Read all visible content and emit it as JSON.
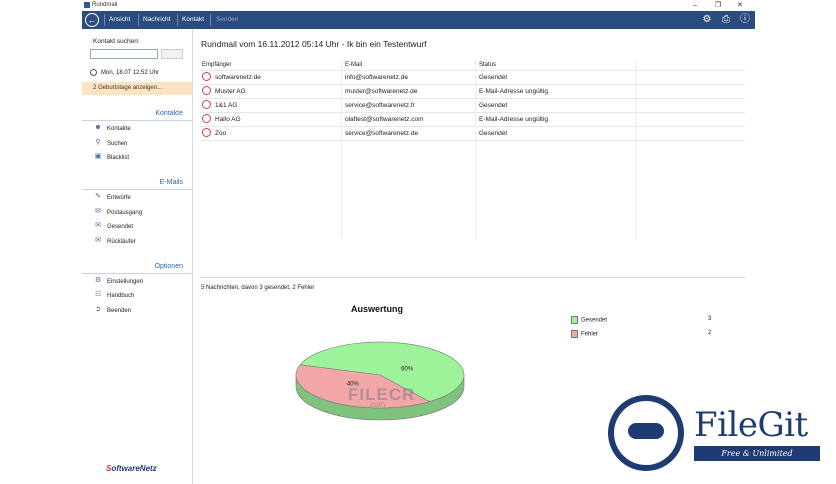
{
  "window": {
    "title": "Rundmail",
    "controls": [
      "–",
      "❐",
      "✕"
    ]
  },
  "toolbar": {
    "back_icon": "back-arrow-icon",
    "items": [
      {
        "label": "Ansicht",
        "enabled": true
      },
      {
        "label": "Nachricht",
        "enabled": true
      },
      {
        "label": "Kontakt",
        "enabled": true
      },
      {
        "label": "Senden",
        "enabled": false
      }
    ],
    "right_icons": [
      "gear-icon",
      "printer-icon",
      "info-icon"
    ]
  },
  "sidebar": {
    "search_label": "Kontakt suchen:",
    "search_value": "",
    "datetime": "Mon, 18.07   12:52 Uhr",
    "birthday": "2 Geburtstage anzeigen...",
    "sections": [
      {
        "title": "Kontakte",
        "items": [
          "Kontakte",
          "Suchen",
          "Blacklist"
        ]
      },
      {
        "title": "E-Mails",
        "items": [
          "Entwürfe",
          "Postausgang",
          "Gesendet",
          "Rückläufer"
        ]
      },
      {
        "title": "Optionen",
        "items": [
          "Einstellungen",
          "Handbuch",
          "Beenden"
        ]
      }
    ],
    "logo_prefix": "S",
    "logo_rest": "oftwareNetz"
  },
  "main": {
    "title": "Rundmail vom 16.11.2012 05:14 Uhr - Ik bin ein Testentwurf",
    "columns": [
      "Empfänger",
      "E-Mail",
      "Status"
    ],
    "rows": [
      {
        "recipient": "softwarenetz.de",
        "email": "info@softwarenetz.de",
        "status": "Gesendet"
      },
      {
        "recipient": "Muster AG",
        "email": "muster@softwarenetz.de",
        "status": "E-Mail-Adresse ungültig"
      },
      {
        "recipient": "1&1 AG",
        "email": "service@softwarenetz.fr",
        "status": "Gesendet"
      },
      {
        "recipient": "Hallo AG",
        "email": "olaftest@softwarenetz.com",
        "status": "E-Mail-Adresse ungültig"
      },
      {
        "recipient": "Zoo",
        "email": "service@softwarenetz.de",
        "status": "Gesendet"
      }
    ],
    "summary": "5 Nachrichten, davon 3 gesendet, 2 Fehler"
  },
  "chart_data": {
    "type": "pie",
    "title": "Auswertung",
    "categories": [
      "Gesendet",
      "Fehler"
    ],
    "values": [
      3,
      2
    ],
    "labels": [
      "60%",
      "40%"
    ],
    "colors": [
      "#9ef29a",
      "#f3a6a6"
    ],
    "legend": "right"
  },
  "watermarks": {
    "filecr_main": "FILECR",
    "filecr_sub": ".com",
    "filegit_name": "FileGit",
    "filegit_tagline": "Free & Unlimited"
  }
}
